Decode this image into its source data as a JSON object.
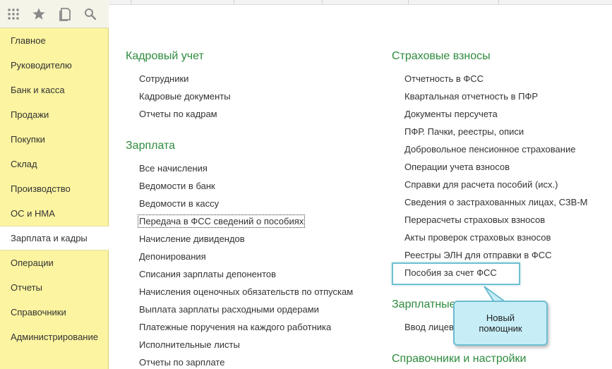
{
  "sidebar": {
    "items": [
      {
        "label": "Главное"
      },
      {
        "label": "Руководителю"
      },
      {
        "label": "Банк и касса"
      },
      {
        "label": "Продажи"
      },
      {
        "label": "Покупки"
      },
      {
        "label": "Склад"
      },
      {
        "label": "Производство"
      },
      {
        "label": "ОС и НМА"
      },
      {
        "label": "Зарплата и кадры"
      },
      {
        "label": "Операции"
      },
      {
        "label": "Отчеты"
      },
      {
        "label": "Справочники"
      },
      {
        "label": "Администрирование"
      }
    ],
    "active_index": 8
  },
  "toolbar": {
    "icons": [
      "apps-grid-icon",
      "star-icon",
      "history-icon",
      "search-icon"
    ]
  },
  "left_column": {
    "sections": [
      {
        "title": "Кадровый учет",
        "links": [
          "Сотрудники",
          "Кадровые документы",
          "Отчеты по кадрам"
        ]
      },
      {
        "title": "Зарплата",
        "links": [
          "Все начисления",
          "Ведомости в банк",
          "Ведомости в кассу",
          "Передача в ФСС сведений о пособиях",
          "Начисление дивидендов",
          "Депонирования",
          "Списания зарплаты депонентов",
          "Начисления оценочных обязательств по отпускам",
          "Выплата зарплаты расходными ордерами",
          "Платежные поручения на каждого работника",
          "Исполнительные листы",
          "Отчеты по зарплате"
        ]
      }
    ]
  },
  "right_column": {
    "sections": [
      {
        "title": "Страховые взносы",
        "links": [
          "Отчетность в ФСС",
          "Квартальная отчетность в ПФР",
          "Документы персучета",
          "ПФР. Пачки, реестры, описи",
          "Добровольное пенсионное страхование",
          "Операции учета взносов",
          "Справки для расчета пособий (исх.)",
          "Сведения о застрахованных лицах, СЗВ-М",
          "Перерасчеты страховых взносов",
          "Акты проверок страховых взносов",
          "Реестры ЭЛН для отправки в ФСС",
          "Пособия за счет ФСС"
        ]
      },
      {
        "title": "Зарплатные",
        "links": [
          "Ввод лицев"
        ]
      },
      {
        "title": "Справочники и настройки",
        "links": []
      }
    ]
  },
  "callout": {
    "line1": "Новый",
    "line2": "помощник"
  },
  "colors": {
    "sidebar_bg": "#fcf4a0",
    "section_title": "#2e8b3e",
    "callout_bg": "#c7eef7",
    "callout_border": "#6cbcd0"
  }
}
